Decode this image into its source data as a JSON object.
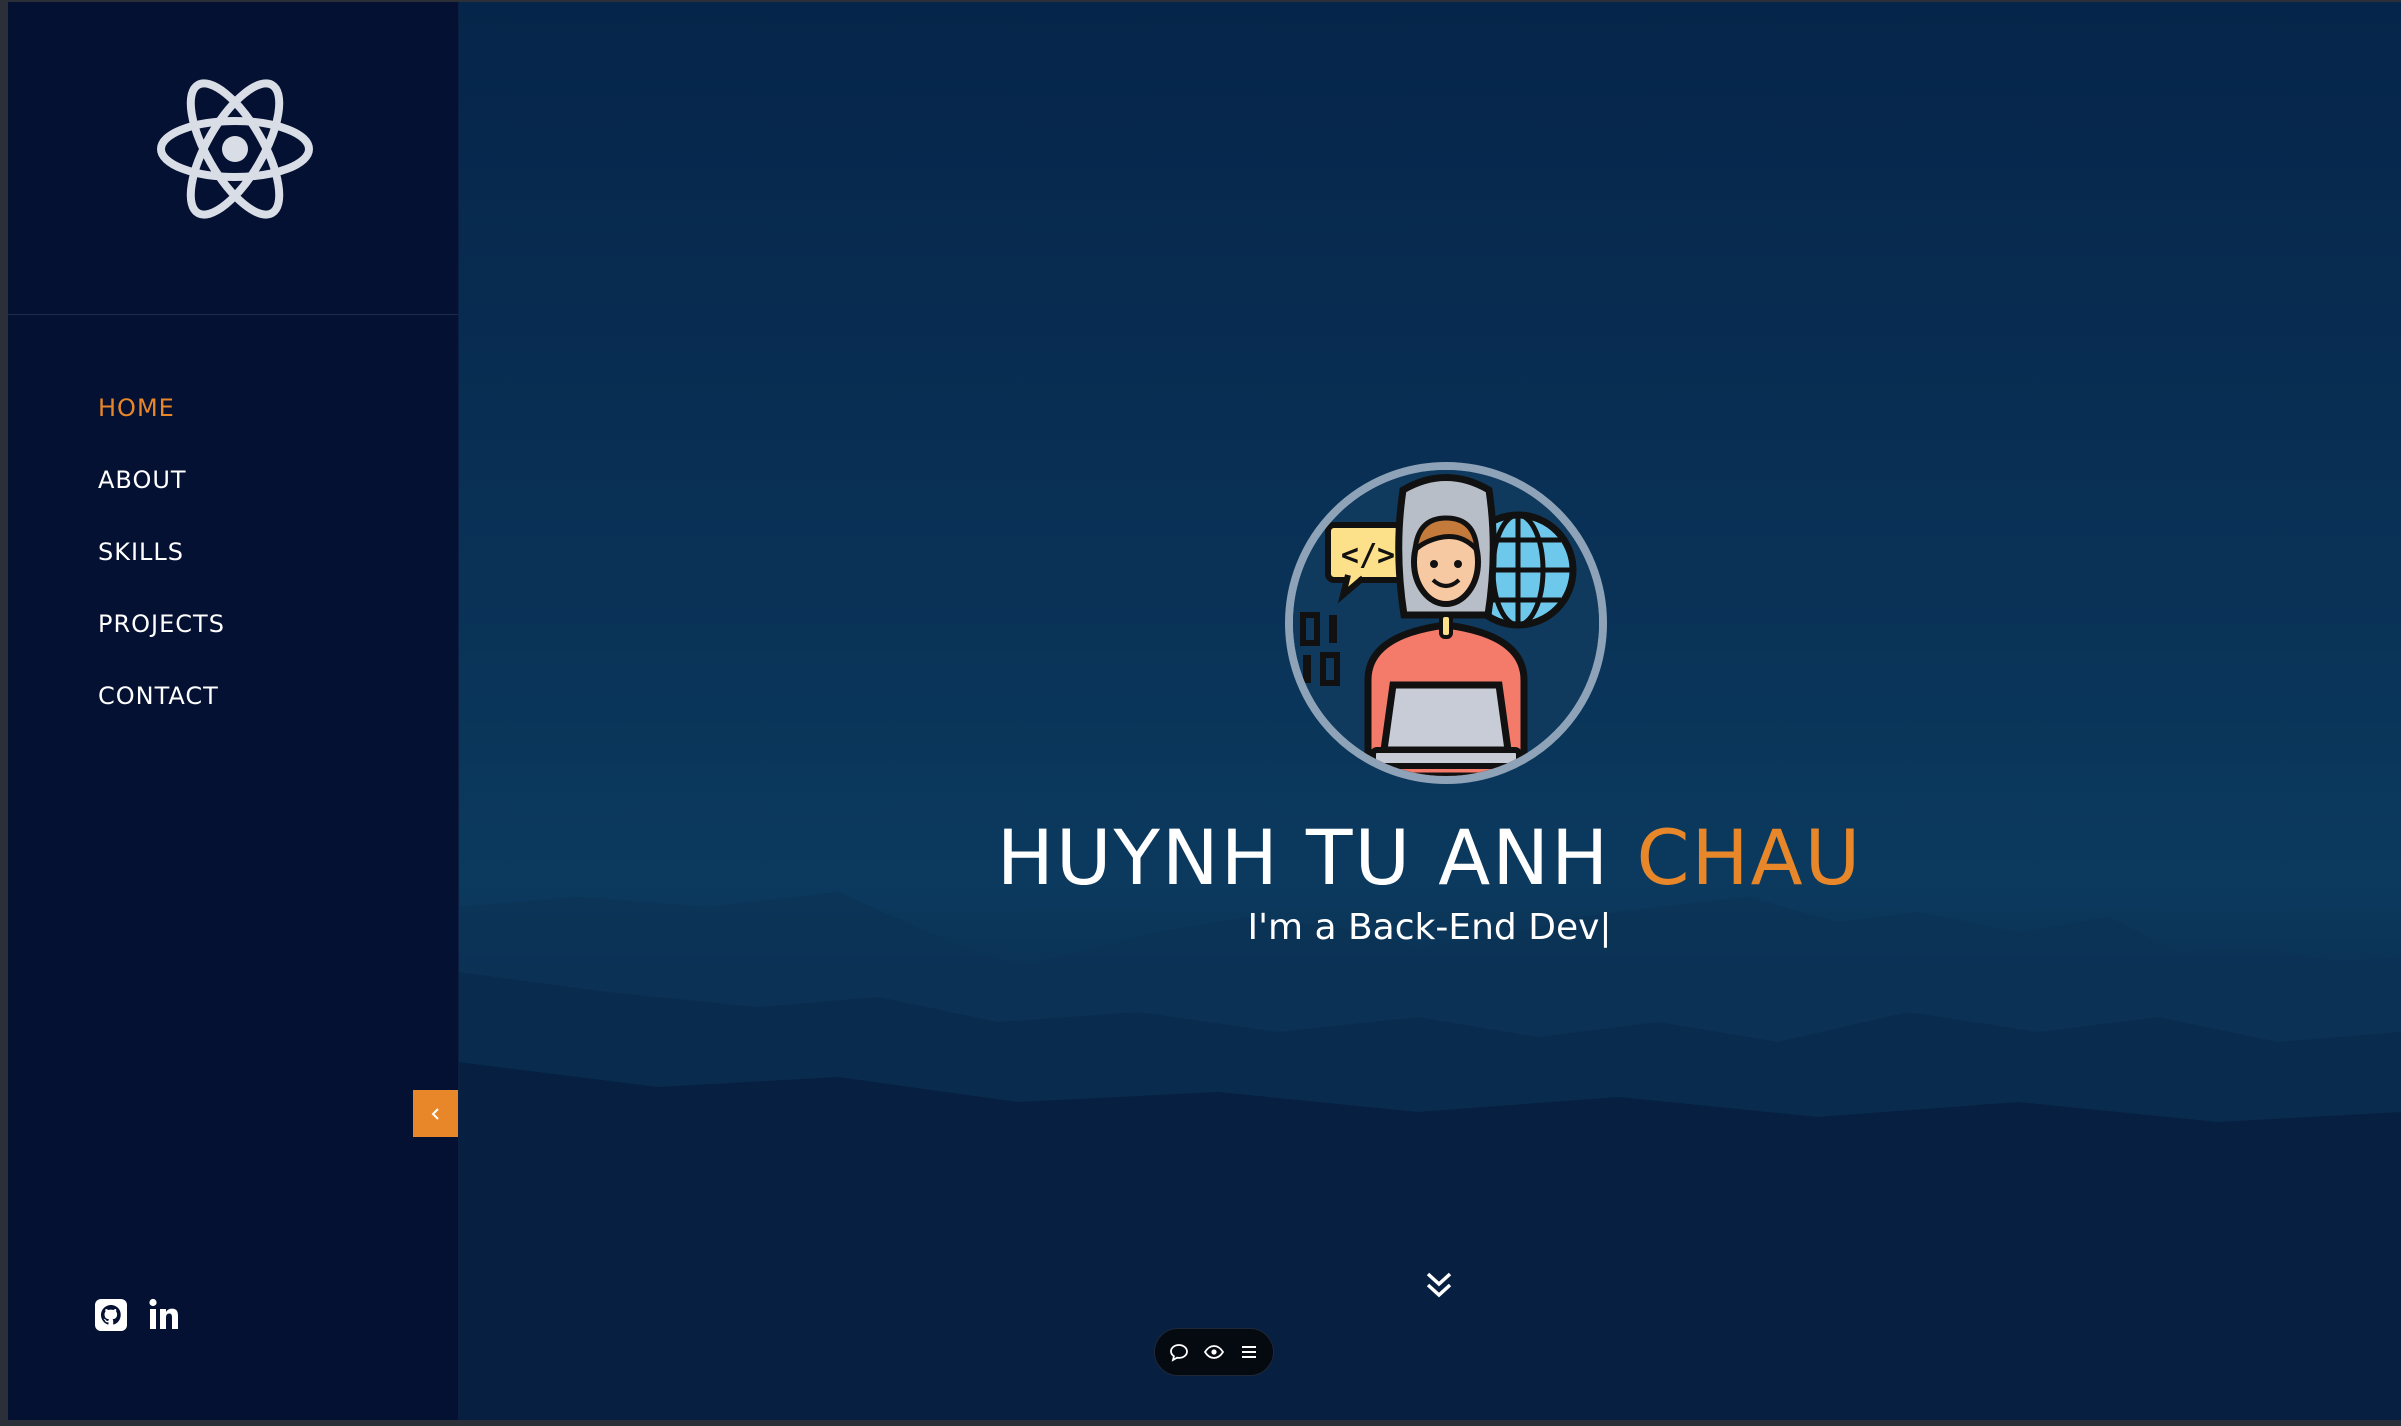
{
  "sidebar": {
    "logo_icon": "react-atom-icon",
    "nav": [
      {
        "label": "HOME",
        "active": true
      },
      {
        "label": "ABOUT",
        "active": false
      },
      {
        "label": "SKILLS",
        "active": false
      },
      {
        "label": "PROJECTS",
        "active": false
      },
      {
        "label": "CONTACT",
        "active": false
      }
    ],
    "collapse_icon": "chevron-left-icon",
    "socials": [
      "github-icon",
      "linkedin-icon"
    ]
  },
  "hero": {
    "avatar_icon": "developer-avatar-icon",
    "name_first": "HUYNH TU ANH",
    "name_last": "CHAU",
    "subtitle": "I'm a Back-End Dev|",
    "scroll_icon": "double-chevron-down-icon"
  },
  "toolbar": {
    "icons": [
      "comment-icon",
      "eye-icon",
      "menu-icon"
    ]
  },
  "colors": {
    "accent": "#e8872a",
    "sidebar_bg": "#051132",
    "hero_top": "#06254a",
    "text": "#ffffff"
  }
}
